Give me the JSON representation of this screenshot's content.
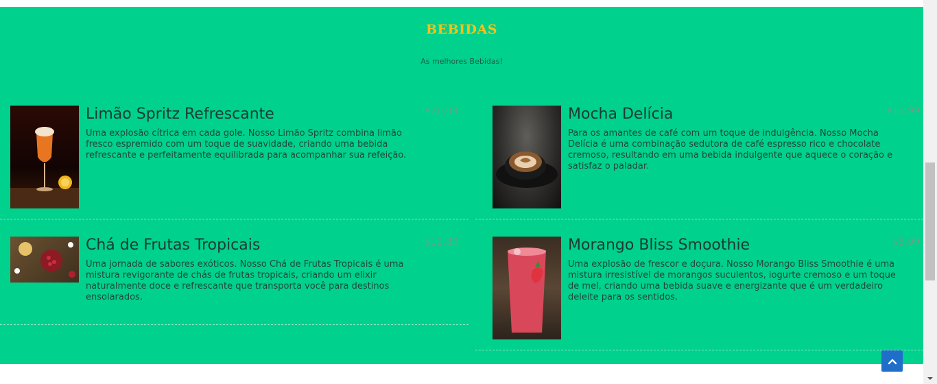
{
  "section": {
    "title": "BEBIDAS",
    "subtitle": "As melhores Bebidas!"
  },
  "items": [
    {
      "name": "Limão Spritz Refrescante",
      "price": "$20,09",
      "description": "Uma explosão cítrica em cada gole. Nosso Limão Spritz combina limão fresco espremido com um toque de suavidade, criando uma bebida refrescante e perfeitamente equilibrada para acompanhar sua refeição.",
      "image_icon": "orange-spritz-drink-image"
    },
    {
      "name": "Mocha Delícia",
      "price": "$10,99",
      "description": "Para os amantes de café com um toque de indulgência. Nosso Mocha Delícia é uma combinação sedutora de café espresso rico e chocolate cremoso, resultando em uma bebida indulgente que aquece o coração e satisfaz o paladar.",
      "image_icon": "coffee-cup-image"
    },
    {
      "name": "Chá de Frutas Tropicais",
      "price": "$12,80",
      "description": "Uma jornada de sabores exóticos. Nosso Chá de Frutas Tropicais é uma mistura revigorante de chás de frutas tropicais, criando um elixir naturalmente doce e refrescante que transporta você para destinos ensolarados.",
      "image_icon": "fruit-tea-image"
    },
    {
      "name": "Morango Bliss Smoothie",
      "price": "$5,99",
      "description": "Uma explosão de frescor e doçura. Nosso Morango Bliss Smoothie é uma mistura irresistível de morangos suculentos, iogurte cremoso e um toque de mel, criando uma bebida suave e energizante que é um verdadeiro deleite para os sentidos.",
      "image_icon": "strawberry-smoothie-image"
    }
  ],
  "colors": {
    "background": "#00d18c",
    "title": "#f5c21b",
    "scroll_top_button": "#1f6ec9"
  },
  "scroll_top_icon": "chevron-up-icon"
}
